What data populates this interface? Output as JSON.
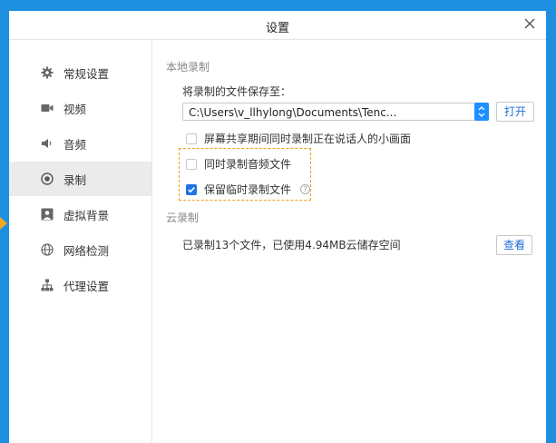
{
  "window": {
    "title": "设置"
  },
  "sidebar": {
    "items": [
      {
        "label": "常规设置",
        "icon": "gear-icon"
      },
      {
        "label": "视频",
        "icon": "camera-icon"
      },
      {
        "label": "音频",
        "icon": "speaker-icon"
      },
      {
        "label": "录制",
        "icon": "record-icon",
        "active": true
      },
      {
        "label": "虚拟背景",
        "icon": "portrait-icon"
      },
      {
        "label": "网络检测",
        "icon": "globe-icon"
      },
      {
        "label": "代理设置",
        "icon": "network-icon"
      }
    ]
  },
  "local_recording": {
    "section_title": "本地录制",
    "save_to_label": "将录制的文件保存至：",
    "save_path": "C:\\Users\\v_llhylong\\Documents\\Tenc...",
    "open_button": "打开",
    "options": [
      {
        "label": "屏幕共享期间同时录制正在说话人的小画面",
        "checked": false
      },
      {
        "label": "同时录制音频文件",
        "checked": false
      },
      {
        "label": "保留临时录制文件",
        "checked": true
      }
    ]
  },
  "cloud_recording": {
    "section_title": "云录制",
    "usage_text": "已录制13个文件，已使用4.94MB云储存空间",
    "view_button": "查看"
  },
  "colors": {
    "accent": "#1e73e6",
    "highlight_border": "#f0a020",
    "backdrop": "#1e8fdf"
  }
}
